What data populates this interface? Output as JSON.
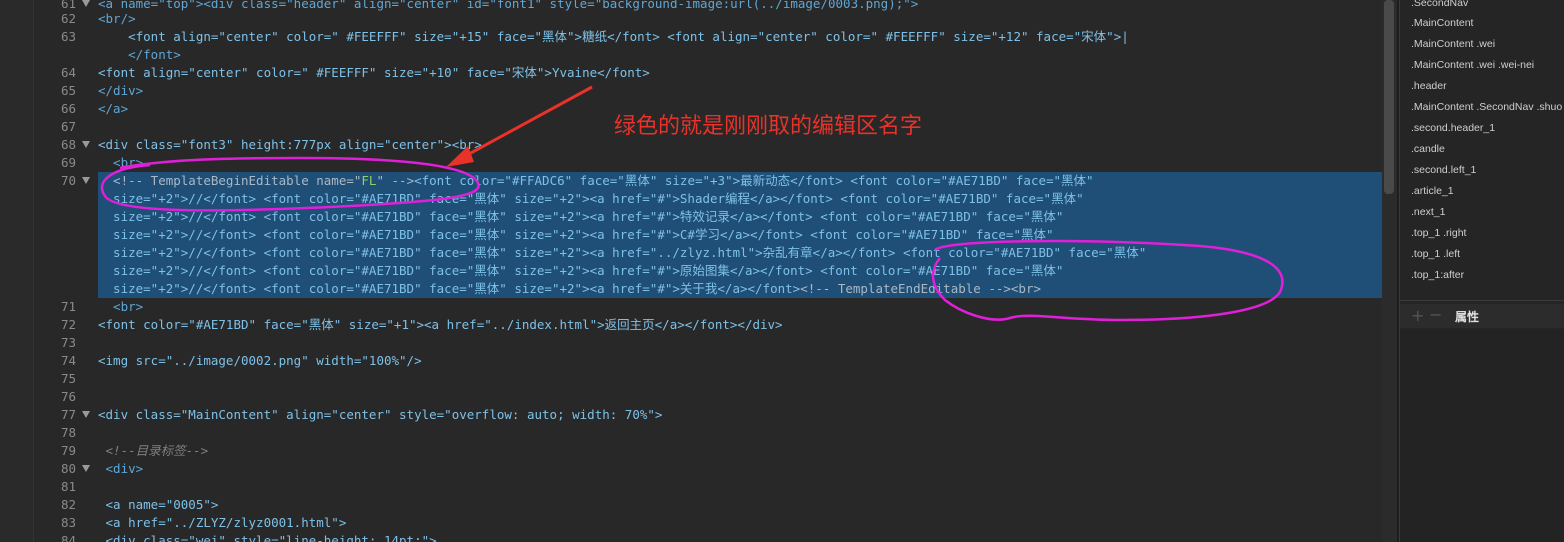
{
  "editor": {
    "lines": [
      {
        "num": "61",
        "top": 0
      },
      {
        "num": "",
        "top": 0
      }
    ],
    "line61": "<a name=\"top\"><div class=\"header\" align=\"center\" id=\"font1\" style=\"background-image:url(../image/0003.png);\">",
    "line62": "<br/>",
    "line63a": "    <font align=\"center\" color=\" #FEEFFF\" size=\"+15\" face=\"黑体\">糖纸</font> <font align=\"center\" color=\" #FEEFFF\" size=\"+12\" face=\"宋体\">|",
    "line63b": "    </font>",
    "line64": "<font align=\"center\" color=\" #FEEFFF\" size=\"+10\" face=\"宋体\">Yvaine</font>",
    "line65": "</div>",
    "line66": "</a>",
    "line67": "",
    "line68": "<div class=\"font3\" height:777px align=\"center\"><br>",
    "line69": "  <br>",
    "line70a_pre": "  <!-- TemplateBeginEditable name=\"",
    "line70a_name": "FL",
    "line70a_post": "\" -->",
    "line70a_rest": "<font color=\"#FFADC6\" face=\"黑体\" size=\"+3\">最新动态</font> <font color=\"#AE71BD\" face=\"黑体\"",
    "line70b": "  size=\"+2\">//</font> <font color=\"#AE71BD\" face=\"黑体\" size=\"+2\"><a href=\"#\">Shader编程</a></font> <font color=\"#AE71BD\" face=\"黑体\"",
    "line70c": "  size=\"+2\">//</font> <font color=\"#AE71BD\" face=\"黑体\" size=\"+2\"><a href=\"#\">特效记录</a></font> <font color=\"#AE71BD\" face=\"黑体\"",
    "line70d": "  size=\"+2\">//</font> <font color=\"#AE71BD\" face=\"黑体\" size=\"+2\"><a href=\"#\">C#学习</a></font> <font color=\"#AE71BD\" face=\"黑体\"",
    "line70e": "  size=\"+2\">//</font> <font color=\"#AE71BD\" face=\"黑体\" size=\"+2\"><a href=\"../zlyz.html\">杂乱有章</a></font> <font color=\"#AE71BD\" face=\"黑体\"",
    "line70f": "  size=\"+2\">//</font> <font color=\"#AE71BD\" face=\"黑体\" size=\"+2\"><a href=\"#\">原始图集</a></font> <font color=\"#AE71BD\" face=\"黑体\"",
    "line70g_a": "  size=\"+2\">//</font> <font color=\"#AE71BD\" face=\"黑体\" size=\"+2\"><a href=\"#\">关于我</a></font>",
    "line70g_b": "<!-- TemplateEndEditable --><br>",
    "line71": "  <br>",
    "line72": "<font color=\"#AE71BD\" face=\"黑体\" size=\"+1\"><a href=\"../index.html\">返回主页</a></font></div>",
    "line73": "",
    "line74": "<img src=\"../image/0002.png\" width=\"100%\"/>",
    "line75": "",
    "line76": "",
    "line77": "<div class=\"MainContent\" align=\"center\" style=\"overflow: auto; width: 70%\">",
    "line78": "",
    "line79": " <!--目录标签-->",
    "line80": " <div>",
    "line81": "",
    "line82": " <a name=\"0005\">",
    "line83": " <a href=\"../ZLYZ/zlyz0001.html\">",
    "line84": " <div class=\"wei\" style=\"line-height: 14pt;\">"
  },
  "line_numbers": [
    "61",
    "62",
    "63",
    "",
    "64",
    "65",
    "66",
    "67",
    "68",
    "69",
    "70",
    "",
    "",
    "",
    "",
    "",
    "",
    "71",
    "72",
    "73",
    "74",
    "75",
    "76",
    "77",
    "78",
    "79",
    "80",
    "81",
    "82",
    "83",
    "84"
  ],
  "annotation": {
    "text": "绿色的就是刚刚取的编辑区名字"
  },
  "css_panel": {
    "items": [
      ".SecondNav",
      ".MainContent",
      ".MainContent .wei",
      ".MainContent .wei .wei-nei",
      ".header",
      ".MainContent .SecondNav .shuo",
      ".second.header_1",
      ".candle",
      ".second.left_1",
      ".article_1",
      ".next_1",
      ".top_1 .right",
      ".top_1 .left",
      ".top_1:after"
    ],
    "props_title": "属性",
    "add_symbol": "+",
    "remove_symbol": "−"
  },
  "colors": {
    "editor_bg": "#282828",
    "selection": "#1f4e77",
    "annotation_red": "#e8322a",
    "circle_magenta": "#e020d8"
  }
}
